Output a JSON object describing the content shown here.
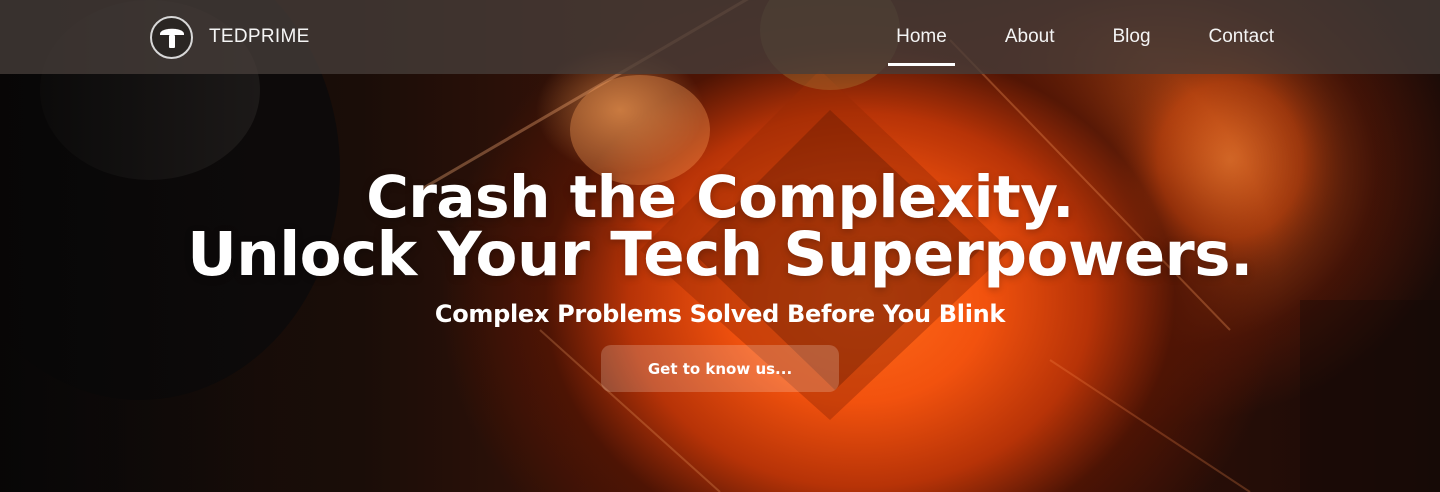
{
  "header": {
    "brand_name": "TEDPRIME",
    "logo_icon": "t-mushroom-logo-icon",
    "nav": [
      {
        "label": "Home",
        "active": true
      },
      {
        "label": "About",
        "active": false
      },
      {
        "label": "Blog",
        "active": false
      },
      {
        "label": "Contact",
        "active": false
      }
    ]
  },
  "hero": {
    "headline_line1": "Crash the Complexity.",
    "headline_line2": "Unlock Your Tech Superpowers.",
    "subheadline": "Complex Problems Solved Before You Blink",
    "cta_label": "Get to know us...",
    "background_icon": "abstract-orange-tech-background"
  },
  "colors": {
    "accent": "#f2520e",
    "navbar": "#46403c",
    "text": "#ffffff"
  }
}
